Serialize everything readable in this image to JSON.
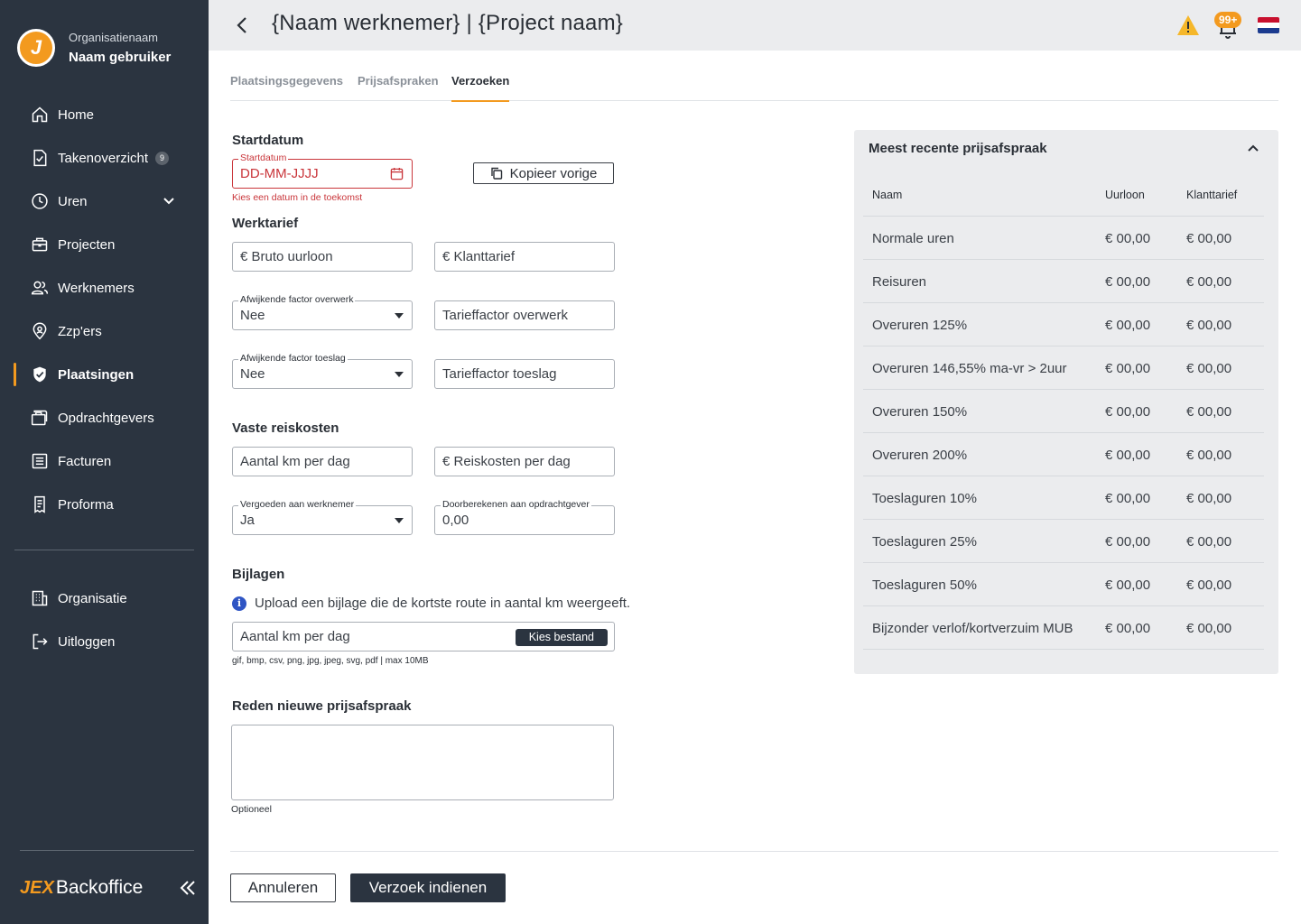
{
  "sidebar": {
    "org_name": "Organisatienaam",
    "user_name": "Naam gebruiker",
    "logo_letter": "J",
    "items": [
      {
        "label": "Home",
        "icon": "home-icon"
      },
      {
        "label": "Takenoverzicht",
        "icon": "task-icon",
        "badge": "9"
      },
      {
        "label": "Uren",
        "icon": "clock-icon"
      },
      {
        "label": "Projecten",
        "icon": "briefcase-icon"
      },
      {
        "label": "Werknemers",
        "icon": "users-icon"
      },
      {
        "label": "Zzp'ers",
        "icon": "location-icon"
      },
      {
        "label": "Plaatsingen",
        "icon": "shield-check-icon",
        "active": true
      },
      {
        "label": "Opdrachtgevers",
        "icon": "clients-icon"
      },
      {
        "label": "Facturen",
        "icon": "invoice-icon"
      },
      {
        "label": "Proforma",
        "icon": "proforma-icon"
      }
    ],
    "bottom_items": [
      {
        "label": "Organisatie",
        "icon": "building-icon"
      },
      {
        "label": "Uitloggen",
        "icon": "logout-icon"
      }
    ],
    "brand_jex": "JEX",
    "brand_text": "Backoffice"
  },
  "header": {
    "title": "{Naam werknemer} | {Project naam}",
    "notification_count": "99+"
  },
  "tabs": [
    {
      "label": "Plaatsingsgegevens"
    },
    {
      "label": "Prijsafspraken"
    },
    {
      "label": "Verzoeken",
      "active": true
    }
  ],
  "form": {
    "startdatum_title": "Startdatum",
    "startdatum_label": "Startdatum",
    "startdatum_placeholder": "DD-MM-JJJJ",
    "startdatum_error": "Kies een datum in de toekomst",
    "kopieer_label": "Kopieer vorige",
    "werktarief_title": "Werktarief",
    "bruto_uurloon": "€ Bruto uurloon",
    "klanttarief": "€ Klanttarief",
    "factor_overwerk_label": "Afwijkende factor overwerk",
    "factor_overwerk_value": "Nee",
    "tarieffactor_overwerk": "Tarieffactor overwerk",
    "factor_toeslag_label": "Afwijkende factor toeslag",
    "factor_toeslag_value": "Nee",
    "tarieffactor_toeslag": "Tarieffactor toeslag",
    "reiskosten_title": "Vaste reiskosten",
    "km_per_dag": "Aantal km per dag",
    "reiskosten_per_dag": "€ Reiskosten per dag",
    "vergoeden_label": "Vergoeden aan werknemer",
    "vergoeden_value": "Ja",
    "doorberekenen_label": "Doorberekenen aan opdrachtgever",
    "doorberekenen_value": "0,00",
    "bijlagen_title": "Bijlagen",
    "bijlagen_info": "Upload een bijlage die de kortste route in aantal km weergeeft.",
    "upload_field": "Aantal km per dag",
    "kies_bestand": "Kies bestand",
    "file_types": "gif, bmp, csv, png, jpg, jpeg, svg, pdf | max 10MB",
    "reden_title": "Reden nieuwe prijsafspraak",
    "reden_helper": "Optioneel"
  },
  "footer": {
    "cancel": "Annuleren",
    "submit": "Verzoek indienen"
  },
  "panel": {
    "title": "Meest recente prijsafspraak",
    "columns": [
      "Naam",
      "Uurloon",
      "Klanttarief"
    ],
    "rows": [
      [
        "Normale uren",
        "€ 00,00",
        "€ 00,00"
      ],
      [
        "Reisuren",
        "€ 00,00",
        "€ 00,00"
      ],
      [
        "Overuren 125%",
        "€ 00,00",
        "€ 00,00"
      ],
      [
        "Overuren 146,55% ma-vr > 2uur",
        "€ 00,00",
        "€ 00,00"
      ],
      [
        "Overuren 150%",
        "€ 00,00",
        "€ 00,00"
      ],
      [
        "Overuren 200%",
        "€ 00,00",
        "€ 00,00"
      ],
      [
        "Toeslaguren 10%",
        "€ 00,00",
        "€ 00,00"
      ],
      [
        "Toeslaguren 25%",
        "€ 00,00",
        "€ 00,00"
      ],
      [
        "Toeslaguren 50%",
        "€ 00,00",
        "€ 00,00"
      ],
      [
        "Bijzonder verlof/kortverzuim MUB",
        "€ 00,00",
        "€ 00,00"
      ]
    ]
  },
  "colors": {
    "sidebar_bg": "#2b3440",
    "accent": "#f39a1f",
    "error": "#c9353a",
    "header_bg": "#ebecee"
  }
}
